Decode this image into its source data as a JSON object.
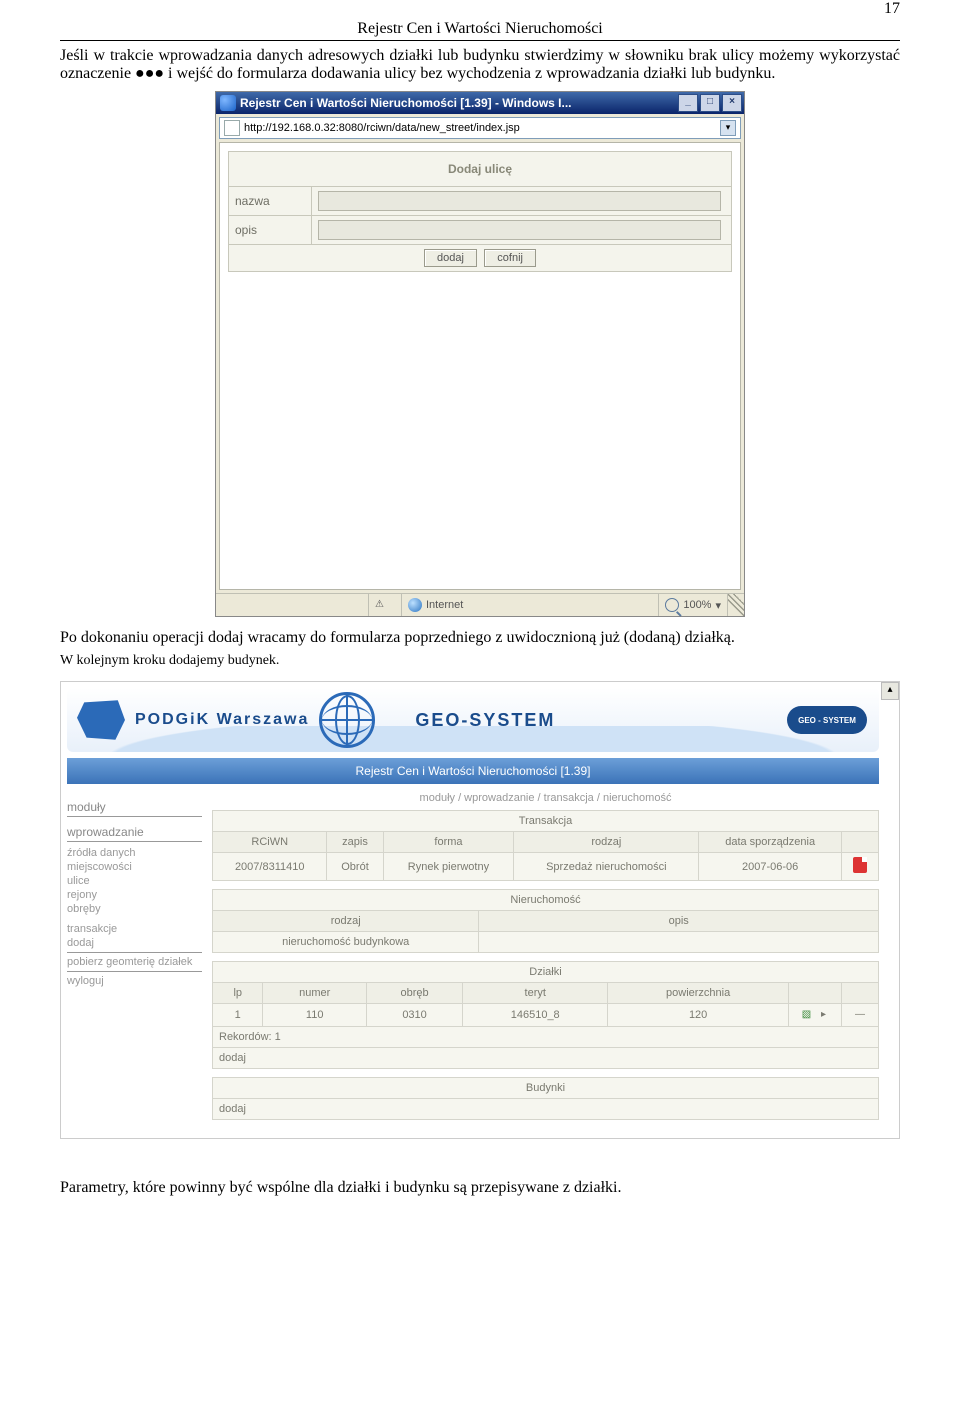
{
  "header": {
    "title": "Rejestr Cen i Wartości Nieruchomości",
    "page_number": "17"
  },
  "para1": "Jeśli w trakcie wprowadzania danych adresowych działki lub budynku stwierdzimy w słowniku brak ulicy możemy wykorzystać oznaczenie ●●● i wejść do formularza dodawania ulicy bez wychodzenia z wprowadzania działki lub budynku.",
  "popup": {
    "title": "Rejestr Cen i Wartości Nieruchomości [1.39] - Windows I...",
    "url": "http://192.168.0.32:8080/rciwn/data/new_street/index.jsp",
    "form_title": "Dodaj ulicę",
    "label_name": "nazwa",
    "label_desc": "opis",
    "btn_add": "dodaj",
    "btn_cancel": "cofnij",
    "status_zone": "Internet",
    "zoom": "100%"
  },
  "para2": "Po dokonaniu operacji dodaj wracamy do formularza poprzedniego z uwidocznioną już (dodaną) działką.",
  "para3": "W kolejnym kroku dodajemy budynek.",
  "banner": {
    "brand1": "PODGiK Warszawa",
    "brand2": "GEO-SYSTEM",
    "badge": "GEO - SYSTEM",
    "subtitle": "Rejestr Cen i Wartości Nieruchomości [1.39]"
  },
  "sidebar": {
    "grp1": "moduły",
    "grp2": "wprowadzanie",
    "links2": [
      "źródła danych",
      "miejscowości",
      "ulice",
      "rejony",
      "obręby"
    ],
    "links3": [
      "transakcje",
      "dodaj"
    ],
    "links4": [
      "pobierz geomterię działek"
    ],
    "links5": [
      "wyloguj"
    ]
  },
  "main": {
    "breadcrumb": "moduły / wprowadzanie / transakcja / nieruchomość",
    "trans_title": "Transakcja",
    "trans_cols": [
      "RCiWN",
      "zapis",
      "forma",
      "rodzaj",
      "data sporządzenia"
    ],
    "trans_row": [
      "2007/8311410",
      "Obrót",
      "Rynek pierwotny",
      "Sprzedaż nieruchomości",
      "2007-06-06"
    ],
    "nier_title": "Nieruchomość",
    "nier_cols": [
      "rodzaj",
      "opis"
    ],
    "nier_row": [
      "nieruchomość budynkowa",
      ""
    ],
    "dzialki_title": "Działki",
    "dz_cols": [
      "lp",
      "numer",
      "obręb",
      "teryt",
      "powierzchnia"
    ],
    "dz_row": [
      "1",
      "110",
      "0310",
      "146510_8",
      "120"
    ],
    "rekordow": "Rekordów: 1",
    "dodaj": "dodaj",
    "budynki_title": "Budynki"
  },
  "para4": "Parametry, które powinny być wspólne dla działki i budynku są przepisywane z działki."
}
